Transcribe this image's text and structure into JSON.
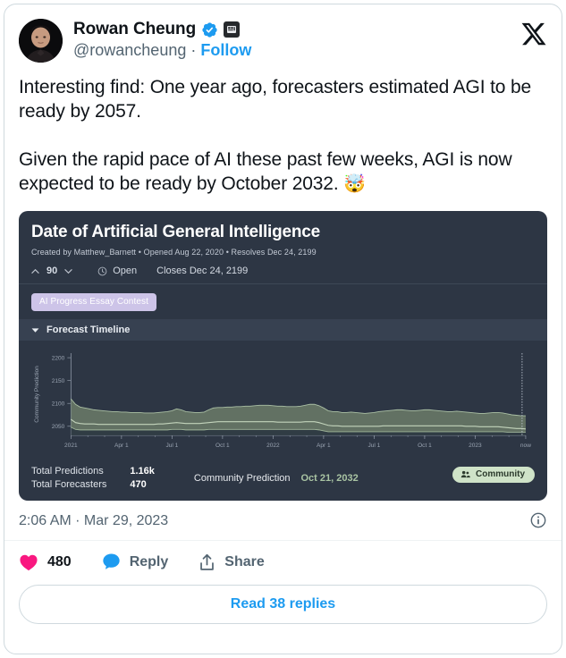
{
  "author": {
    "display_name": "Rowan Cheung",
    "handle": "@rowancheung",
    "separator": "·",
    "follow_label": "Follow",
    "verified_icon": "verified-badge-icon",
    "affiliate_icon": "affiliate-badge-icon",
    "avatar_icon": "avatar"
  },
  "brand": {
    "logo_icon": "x-logo-icon"
  },
  "tweet": {
    "paragraph_1": "Interesting find: One year ago, forecasters estimated AGI to be ready by 2057.",
    "paragraph_2": "Given the rapid pace of AI these past few weeks, AGI is now expected to be ready by October 2032.",
    "emoji": "🤯"
  },
  "embed": {
    "title": "Date of Artificial General Intelligence",
    "subtitle": "Created by Matthew_Barnett • Opened Aug 22, 2020 • Resolves Dec 24, 2199",
    "vote_count": "90",
    "status": "Open",
    "closes": "Closes Dec 24, 2199",
    "tag": "AI Progress Essay Contest",
    "section_label": "Forecast Timeline",
    "upvote_icon": "chevron-up-icon",
    "downvote_icon": "chevron-down-icon",
    "clock_icon": "clock-icon",
    "collapse_icon": "caret-down-icon",
    "footer": {
      "total_predictions_label": "Total Predictions",
      "total_predictions_value": "1.16k",
      "total_forecasters_label": "Total Forecasters",
      "total_forecasters_value": "470",
      "community_prediction_label": "Community Prediction",
      "community_prediction_value": "Oct 21, 2032",
      "community_pill_label": "Community",
      "community_icon": "people-icon"
    }
  },
  "chart_data": {
    "type": "area",
    "title": "Forecast Timeline",
    "xlabel": "",
    "ylabel": "Community Prediction",
    "ylim": [
      2030,
      2210
    ],
    "yticks": [
      2050,
      2100,
      2150,
      2200
    ],
    "ytick_labels": [
      "2050",
      "2100",
      "2150",
      "2200"
    ],
    "xtick_labels": [
      "2021",
      "Apr 1",
      "Jul 1",
      "Oct 1",
      "2022",
      "Apr 1",
      "Jul 1",
      "Oct 1",
      "2023",
      "now"
    ],
    "grid": false,
    "legend_position": "none",
    "colors": {
      "band_fill": "#6e7f6a",
      "median_line": "#c3d4bc",
      "lower_line": "#9fb59a",
      "plot_background": "#2d3644",
      "axis": "#8e98a6"
    },
    "series": [
      {
        "name": "Upper bound",
        "values": [
          2110,
          2098,
          2092,
          2090,
          2088,
          2086,
          2085,
          2084,
          2083,
          2082,
          2082,
          2081,
          2081,
          2080,
          2080,
          2080,
          2079,
          2079,
          2079,
          2080,
          2081,
          2082,
          2084,
          2088,
          2086,
          2082,
          2081,
          2080,
          2080,
          2081,
          2086,
          2090,
          2091,
          2091,
          2092,
          2092,
          2093,
          2093,
          2094,
          2094,
          2095,
          2096,
          2096,
          2096,
          2095,
          2094,
          2094,
          2093,
          2093,
          2093,
          2094,
          2096,
          2098,
          2098,
          2095,
          2090,
          2084,
          2082,
          2082,
          2080,
          2080,
          2081,
          2080,
          2079,
          2078,
          2079,
          2080,
          2082,
          2083,
          2084,
          2085,
          2086,
          2086,
          2085,
          2084,
          2084,
          2085,
          2086,
          2086,
          2085,
          2084,
          2083,
          2082,
          2082,
          2083,
          2082,
          2081,
          2080,
          2079,
          2078,
          2078,
          2079,
          2080,
          2080,
          2079,
          2077,
          2075,
          2074,
          2073,
          2073
        ]
      },
      {
        "name": "Median (Community Prediction)",
        "values": [
          2065,
          2058,
          2056,
          2055,
          2055,
          2055,
          2054,
          2054,
          2054,
          2054,
          2054,
          2054,
          2054,
          2054,
          2054,
          2054,
          2054,
          2054,
          2054,
          2055,
          2055,
          2056,
          2057,
          2058,
          2057,
          2056,
          2056,
          2056,
          2056,
          2057,
          2058,
          2059,
          2060,
          2060,
          2060,
          2060,
          2060,
          2060,
          2060,
          2060,
          2060,
          2060,
          2060,
          2060,
          2060,
          2059,
          2059,
          2059,
          2059,
          2059,
          2059,
          2060,
          2060,
          2060,
          2058,
          2055,
          2052,
          2051,
          2051,
          2050,
          2050,
          2050,
          2050,
          2050,
          2050,
          2050,
          2050,
          2050,
          2051,
          2051,
          2051,
          2051,
          2051,
          2051,
          2051,
          2051,
          2051,
          2051,
          2051,
          2051,
          2051,
          2051,
          2051,
          2051,
          2051,
          2051,
          2050,
          2050,
          2050,
          2049,
          2049,
          2049,
          2049,
          2049,
          2048,
          2047,
          2046,
          2045,
          2045,
          2044
        ]
      },
      {
        "name": "Lower bound",
        "values": [
          2048,
          2043,
          2042,
          2042,
          2042,
          2042,
          2042,
          2042,
          2042,
          2042,
          2042,
          2042,
          2042,
          2042,
          2042,
          2042,
          2042,
          2042,
          2042,
          2042,
          2042,
          2042,
          2043,
          2043,
          2043,
          2042,
          2042,
          2042,
          2042,
          2042,
          2043,
          2043,
          2043,
          2043,
          2043,
          2043,
          2043,
          2043,
          2043,
          2043,
          2043,
          2043,
          2043,
          2043,
          2043,
          2043,
          2043,
          2043,
          2043,
          2043,
          2043,
          2043,
          2043,
          2043,
          2042,
          2040,
          2038,
          2038,
          2038,
          2038,
          2038,
          2038,
          2038,
          2038,
          2038,
          2038,
          2038,
          2038,
          2038,
          2038,
          2038,
          2038,
          2038,
          2038,
          2038,
          2038,
          2038,
          2038,
          2038,
          2038,
          2038,
          2038,
          2038,
          2038,
          2038,
          2038,
          2038,
          2038,
          2038,
          2038,
          2038,
          2038,
          2038,
          2038,
          2038,
          2037,
          2037,
          2037,
          2037,
          2037
        ]
      }
    ],
    "now_marker": {
      "label": "now",
      "visible": true
    }
  },
  "timestamp": "2:06 AM · Mar 29, 2023",
  "info_icon": "info-circle-icon",
  "actions": {
    "like_count": "480",
    "like_icon": "heart-icon",
    "reply_label": "Reply",
    "reply_icon": "comment-bubble-icon",
    "share_label": "Share",
    "share_icon": "share-icon"
  },
  "read_replies_label": "Read 38 replies",
  "colors": {
    "accent": "#1d9bf0",
    "like": "#f91880",
    "reply": "#1d9bf0",
    "text": "#0f1419",
    "muted": "#536471",
    "embed_bg": "#2d3644"
  }
}
